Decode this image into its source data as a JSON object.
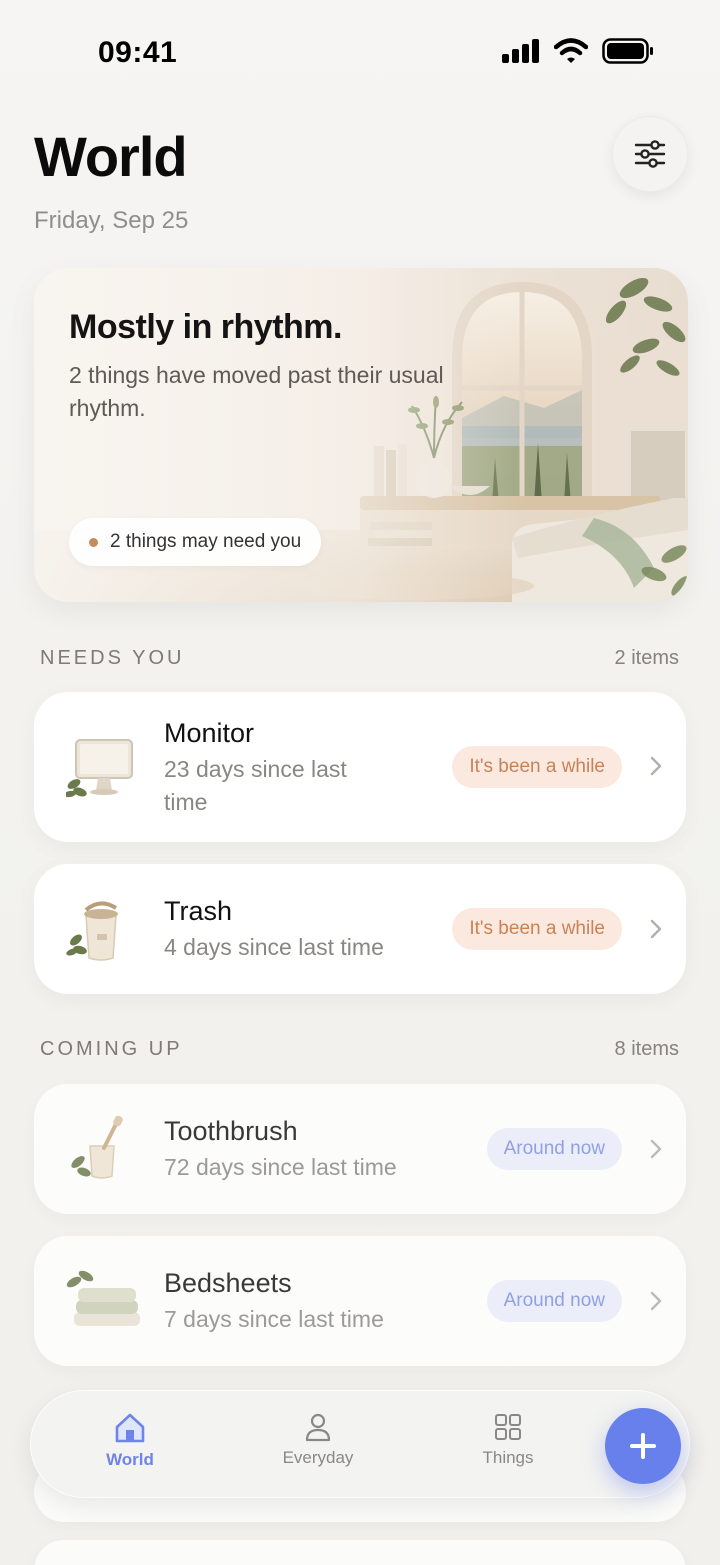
{
  "status_bar": {
    "time": "09:41"
  },
  "header": {
    "title": "World",
    "date": "Friday, Sep 25"
  },
  "hero": {
    "title": "Mostly in rhythm.",
    "subtitle": "2 things have moved past their usual rhythm.",
    "pill": "2 things may need you"
  },
  "needs_you": {
    "label": "NEEDS YOU",
    "count": "2 items",
    "items": [
      {
        "name": "Monitor",
        "sub": "23 days since last time",
        "badge": "It's been a while",
        "icon": "monitor-icon"
      },
      {
        "name": "Trash",
        "sub": "4 days since last time",
        "badge": "It's been a while",
        "icon": "trash-bin-icon"
      }
    ]
  },
  "coming_up": {
    "label": "COMING UP",
    "count": "8 items",
    "items": [
      {
        "name": "Toothbrush",
        "sub": "72 days since last time",
        "badge": "Around now",
        "icon": "toothbrush-cup-icon"
      },
      {
        "name": "Bedsheets",
        "sub": "7 days since last time",
        "badge": "Around now",
        "icon": "folded-sheets-icon"
      }
    ]
  },
  "tab_bar": {
    "tabs": [
      {
        "label": "World",
        "icon": "home-icon",
        "active": true
      },
      {
        "label": "Everyday",
        "icon": "person-icon",
        "active": false
      },
      {
        "label": "Things",
        "icon": "grid-icon",
        "active": false
      }
    ],
    "fab_icon": "plus-icon"
  },
  "colors": {
    "accent": "#6880ec",
    "warm_badge_bg": "#fbe9df",
    "warm_badge_text": "#c98256",
    "cool_badge_bg": "#eaeefc",
    "cool_badge_text": "#7c8fe0"
  }
}
